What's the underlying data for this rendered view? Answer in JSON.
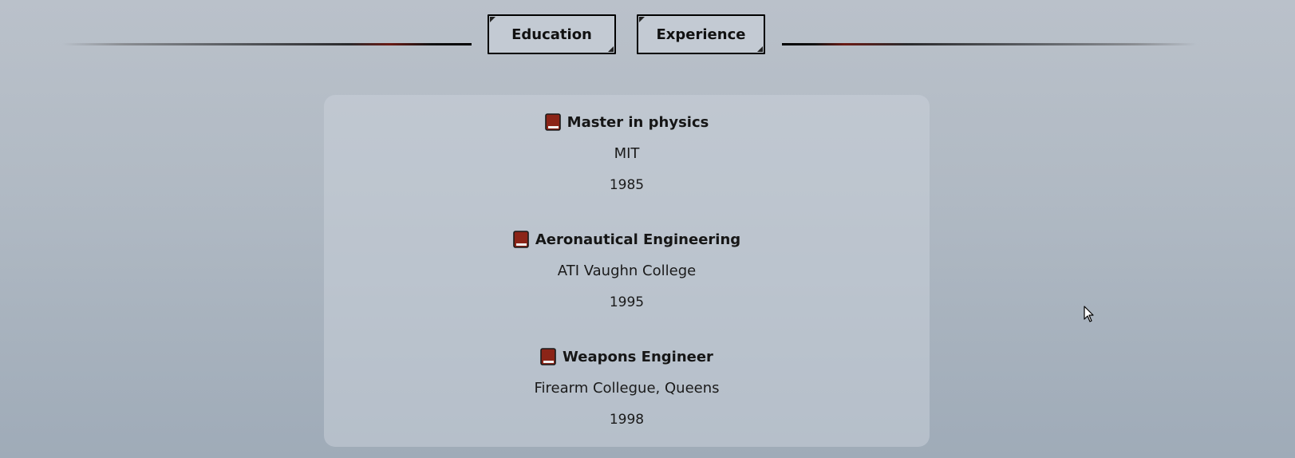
{
  "tabs": [
    {
      "label": "Education"
    },
    {
      "label": "Experience"
    }
  ],
  "education": [
    {
      "degree": "Master in physics",
      "school": "MIT",
      "year": "1985",
      "icon": "book-icon"
    },
    {
      "degree": "Aeronautical Engineering",
      "school": "ATI Vaughn College",
      "year": "1995",
      "icon": "book-icon"
    },
    {
      "degree": "Weapons Engineer",
      "school": "Firearm Collegue, Queens",
      "year": "1998",
      "icon": "book-icon"
    }
  ],
  "colors": {
    "accent": "#8b2417",
    "tab_background": "#c3cad3",
    "panel_background": "#c8d0d9"
  }
}
